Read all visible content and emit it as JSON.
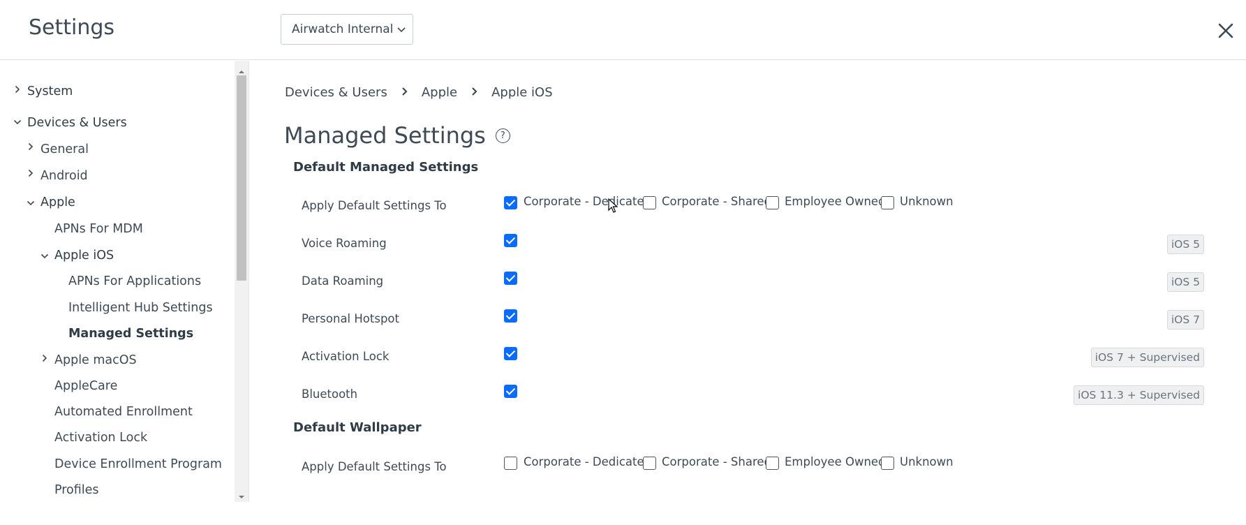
{
  "header": {
    "title": "Settings",
    "org_dropdown": "Airwatch Internal"
  },
  "sidebar": {
    "items": [
      {
        "label": "System"
      },
      {
        "label": "Devices & Users"
      },
      {
        "label": "General"
      },
      {
        "label": "Android"
      },
      {
        "label": "Apple"
      },
      {
        "label": "APNs For MDM"
      },
      {
        "label": "Apple iOS"
      },
      {
        "label": "APNs For Applications"
      },
      {
        "label": "Intelligent Hub Settings"
      },
      {
        "label": "Managed Settings"
      },
      {
        "label": "Apple macOS"
      },
      {
        "label": "AppleCare"
      },
      {
        "label": "Automated Enrollment"
      },
      {
        "label": "Activation Lock"
      },
      {
        "label": "Device Enrollment Program"
      },
      {
        "label": "Profiles"
      }
    ]
  },
  "breadcrumb": [
    "Devices & Users",
    "Apple",
    "Apple iOS"
  ],
  "page_title": "Managed Settings",
  "sections": {
    "default_managed": {
      "heading": "Default Managed Settings",
      "apply_label": "Apply Default Settings To",
      "ownership": [
        "Corporate - Dedicated",
        "Corporate - Shared",
        "Employee Owned",
        "Unknown"
      ],
      "ownership_checked": [
        true,
        false,
        false,
        false
      ],
      "rows": [
        {
          "label": "Voice Roaming",
          "checked": true,
          "badge": "iOS 5"
        },
        {
          "label": "Data Roaming",
          "checked": true,
          "badge": "iOS 5"
        },
        {
          "label": "Personal Hotspot",
          "checked": true,
          "badge": "iOS 7"
        },
        {
          "label": "Activation Lock",
          "checked": true,
          "badge": "iOS 7 + Supervised"
        },
        {
          "label": "Bluetooth",
          "checked": true,
          "badge": "iOS 11.3 + Supervised"
        }
      ]
    },
    "default_wallpaper": {
      "heading": "Default Wallpaper",
      "apply_label": "Apply Default Settings To",
      "ownership": [
        "Corporate - Dedicated",
        "Corporate - Shared",
        "Employee Owned",
        "Unknown"
      ],
      "ownership_checked": [
        false,
        false,
        false,
        false
      ]
    }
  },
  "colors": {
    "accent": "#0a6cff",
    "text": "#3d4a55",
    "badge_bg": "#eef0f2"
  }
}
